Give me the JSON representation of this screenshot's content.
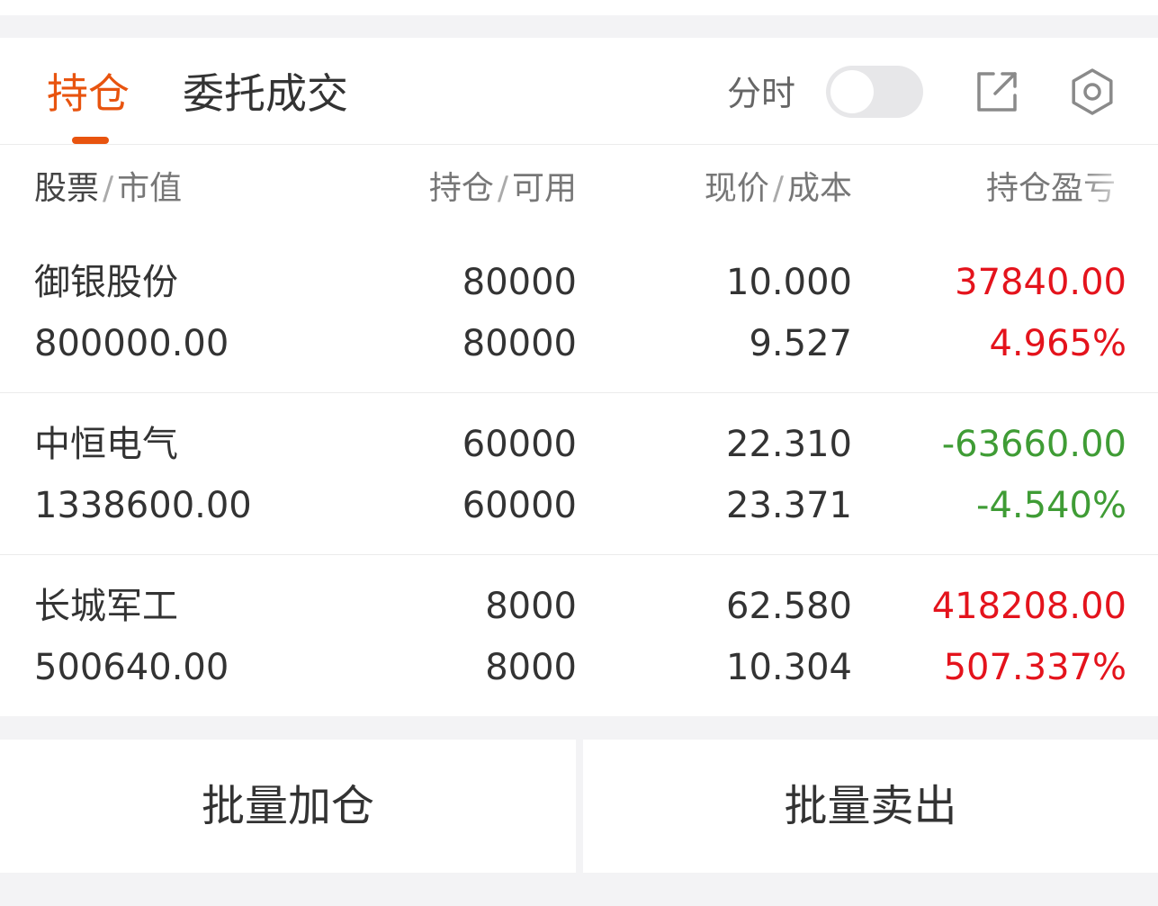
{
  "tabs": [
    {
      "label": "持仓",
      "active": true
    },
    {
      "label": "委托成交",
      "active": false
    }
  ],
  "header": {
    "timeshare_label": "分时",
    "timeshare_enabled": false
  },
  "columns": {
    "stock": {
      "first": "股票",
      "second": "市值"
    },
    "position": {
      "first": "持仓",
      "second": "可用"
    },
    "price": {
      "first": "现价",
      "second": "成本"
    },
    "pl": "持仓盈亏"
  },
  "holdings": [
    {
      "name": "御银股份",
      "market_value": "800000.00",
      "position": "80000",
      "available": "80000",
      "price": "10.000",
      "cost": "9.527",
      "pl": "37840.00",
      "pl_pct": "4.965%",
      "trend": "up"
    },
    {
      "name": "中恒电气",
      "market_value": "1338600.00",
      "position": "60000",
      "available": "60000",
      "price": "22.310",
      "cost": "23.371",
      "pl": "-63660.00",
      "pl_pct": "-4.540%",
      "trend": "down"
    },
    {
      "name": "长城军工",
      "market_value": "500640.00",
      "position": "8000",
      "available": "8000",
      "price": "62.580",
      "cost": "10.304",
      "pl": "418208.00",
      "pl_pct": "507.337%",
      "trend": "up"
    }
  ],
  "buttons": {
    "batch_add": "批量加仓",
    "batch_sell": "批量卖出"
  },
  "colors": {
    "accent": "#e8540f",
    "gain": "#e4131c",
    "loss": "#3f9c35"
  },
  "icons": {
    "share": "share-external-icon",
    "settings": "gear-icon"
  }
}
